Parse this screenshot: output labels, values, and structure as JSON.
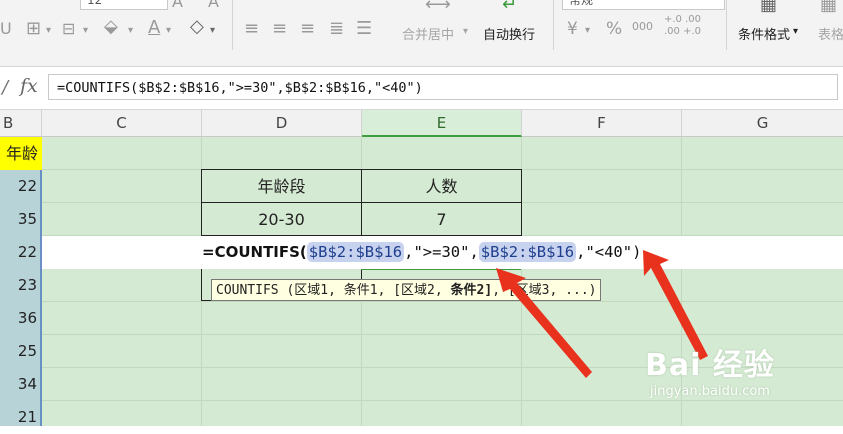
{
  "ribbon": {
    "font_size": "12",
    "merge_center": "合并居中",
    "merge_arrow": "▾",
    "wrap_text": "自动换行",
    "number_format": "常规",
    "currency": "¥",
    "percent": "%",
    "thousands": "000",
    "inc_dec_top": "+.0  .00",
    "inc_dec_bottom": ".00  +.0",
    "conditional_format": "条件格式",
    "conditional_arrow": "▾",
    "table_style": "表格"
  },
  "formula_bar": {
    "fx": "fx",
    "formula": "=COUNTIFS($B$2:$B$16,\">=30\",$B$2:$B$16,\"<40\")"
  },
  "columns": [
    "B",
    "C",
    "D",
    "E",
    "F",
    "G"
  ],
  "active_column": "E",
  "column_b": {
    "header": "年龄",
    "values": [
      "22",
      "35",
      "22",
      "23",
      "36",
      "25",
      "34",
      "21"
    ]
  },
  "table": {
    "header_d": "年龄段",
    "header_e": "人数",
    "row1_d": "20-30",
    "row1_e": "7"
  },
  "cell_edit": {
    "prefix": "=",
    "fn": "COUNTIFS(",
    "ref1": "$B$2:$B$16",
    "mid1": ",\">=30\",",
    "ref2": "$B$2:$B$16",
    "tail": ",\"<40\")"
  },
  "tooltip": {
    "before": "COUNTIFS (区域1, 条件1, [区域2, ",
    "bold": "条件2]",
    "after": ", [区域3, ...)"
  },
  "watermark": {
    "logo": "Bai 经验",
    "url": "jingyan.baidu.com"
  },
  "colors": {
    "grid_bg": "#d5ead3",
    "header_yellow": "#ffff00",
    "arrow_red": "#e8321e"
  }
}
